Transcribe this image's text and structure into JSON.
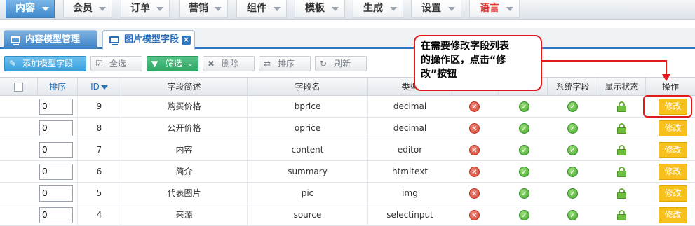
{
  "top_menu": [
    {
      "label": "内容",
      "active": true
    },
    {
      "label": "会员"
    },
    {
      "label": "订单"
    },
    {
      "label": "营销"
    },
    {
      "label": "组件"
    },
    {
      "label": "模板"
    },
    {
      "label": "生成"
    },
    {
      "label": "设置"
    },
    {
      "label": "语言",
      "accent": "#e2332c"
    }
  ],
  "tabs": [
    {
      "label": "内容模型管理",
      "active": false
    },
    {
      "label": "图片模型字段",
      "active": true,
      "close": "×"
    }
  ],
  "toolbar": {
    "add": "添加模型字段",
    "select_all": "全选",
    "filter": "筛选",
    "delete": "删除",
    "sort": "排序",
    "refresh": "刷新"
  },
  "table": {
    "headers": {
      "order": "排序",
      "id": "ID",
      "desc": "字段简述",
      "name": "字段名",
      "type": "类型",
      "system": "系统字段",
      "display": "显示状态",
      "action": "操作"
    },
    "rows": [
      {
        "order": "0",
        "id": "9",
        "desc": "购买价格",
        "name": "bprice",
        "type": "decimal",
        "edit": "修改"
      },
      {
        "order": "0",
        "id": "8",
        "desc": "公开价格",
        "name": "oprice",
        "type": "decimal",
        "edit": "修改"
      },
      {
        "order": "0",
        "id": "7",
        "desc": "内容",
        "name": "content",
        "type": "editor",
        "edit": "修改"
      },
      {
        "order": "0",
        "id": "6",
        "desc": "简介",
        "name": "summary",
        "type": "htmltext",
        "edit": "修改"
      },
      {
        "order": "0",
        "id": "5",
        "desc": "代表图片",
        "name": "pic",
        "type": "img",
        "edit": "修改"
      },
      {
        "order": "0",
        "id": "4",
        "desc": "来源",
        "name": "source",
        "type": "selectinput",
        "edit": "修改"
      }
    ]
  },
  "callout": {
    "line1": "在需要修改字段列表",
    "line2": "的操作区，点击“修",
    "line3": "改”按钮"
  },
  "colors": {
    "primary_blue": "#2f78c0",
    "edit_yellow": "#f7c01d",
    "callout_red": "#e0191b"
  }
}
